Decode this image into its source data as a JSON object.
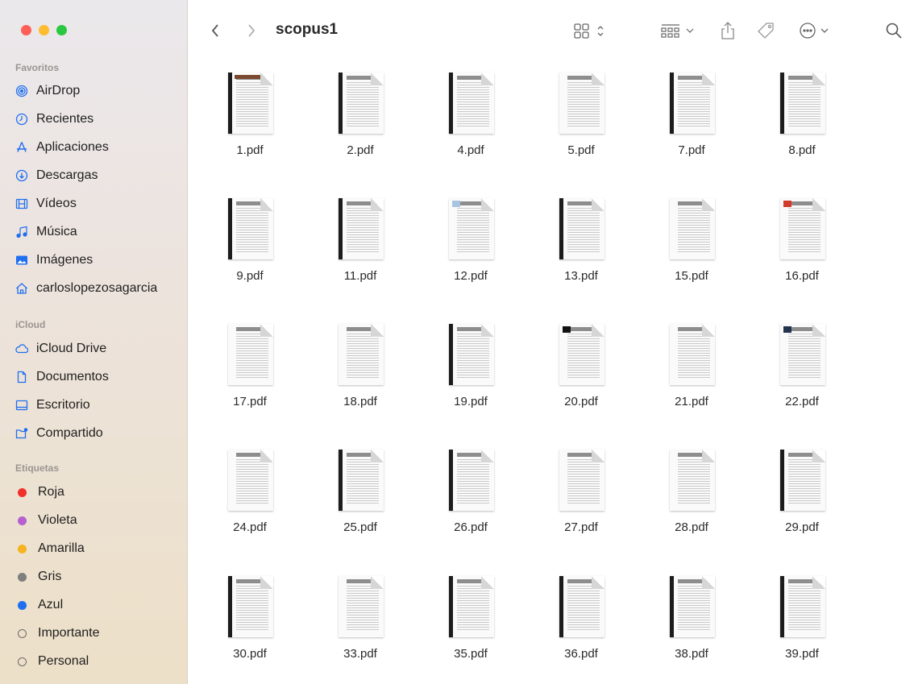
{
  "window": {
    "title": "scopus1"
  },
  "sidebar": {
    "sections": [
      {
        "title": "Favoritos",
        "items": [
          {
            "label": "AirDrop",
            "icon": "airdrop-icon"
          },
          {
            "label": "Recientes",
            "icon": "clock-icon"
          },
          {
            "label": "Aplicaciones",
            "icon": "applications-icon"
          },
          {
            "label": "Descargas",
            "icon": "download-icon"
          },
          {
            "label": "Vídeos",
            "icon": "film-icon"
          },
          {
            "label": "Música",
            "icon": "music-icon"
          },
          {
            "label": "Imágenes",
            "icon": "photo-icon"
          },
          {
            "label": "carloslopezosagarcia",
            "icon": "home-icon"
          }
        ]
      },
      {
        "title": "iCloud",
        "items": [
          {
            "label": "iCloud Drive",
            "icon": "cloud-icon"
          },
          {
            "label": "Documentos",
            "icon": "document-icon"
          },
          {
            "label": "Escritorio",
            "icon": "desktop-icon"
          },
          {
            "label": "Compartido",
            "icon": "shared-folder-icon"
          }
        ]
      },
      {
        "title": "Etiquetas",
        "items": [
          {
            "label": "Roja",
            "color": "#f0302a"
          },
          {
            "label": "Violeta",
            "color": "#b55fd0"
          },
          {
            "label": "Amarilla",
            "color": "#f5b31f"
          },
          {
            "label": "Gris",
            "color": "#7f7f7f"
          },
          {
            "label": "Azul",
            "color": "#1f6ff0"
          },
          {
            "label": "Importante",
            "color": ""
          },
          {
            "label": "Personal",
            "color": ""
          }
        ]
      }
    ]
  },
  "toolbar": {
    "back_icon": "chevron-left-icon",
    "forward_icon": "chevron-right-icon",
    "view_icon": "grid-view-icon",
    "group_icon": "group-by-icon",
    "share_icon": "share-icon",
    "tag_icon": "tag-icon",
    "more_icon": "ellipsis-circle-icon",
    "search_icon": "search-icon"
  },
  "files": [
    "1.pdf",
    "2.pdf",
    "4.pdf",
    "5.pdf",
    "7.pdf",
    "8.pdf",
    "9.pdf",
    "11.pdf",
    "12.pdf",
    "13.pdf",
    "15.pdf",
    "16.pdf",
    "17.pdf",
    "18.pdf",
    "19.pdf",
    "20.pdf",
    "21.pdf",
    "22.pdf",
    "24.pdf",
    "25.pdf",
    "26.pdf",
    "27.pdf",
    "28.pdf",
    "29.pdf",
    "30.pdf",
    "33.pdf",
    "35.pdf",
    "36.pdf",
    "38.pdf",
    "39.pdf"
  ],
  "colors": {
    "sidebar_bg": "#ede3d6",
    "accent": "#1f6ff0"
  }
}
